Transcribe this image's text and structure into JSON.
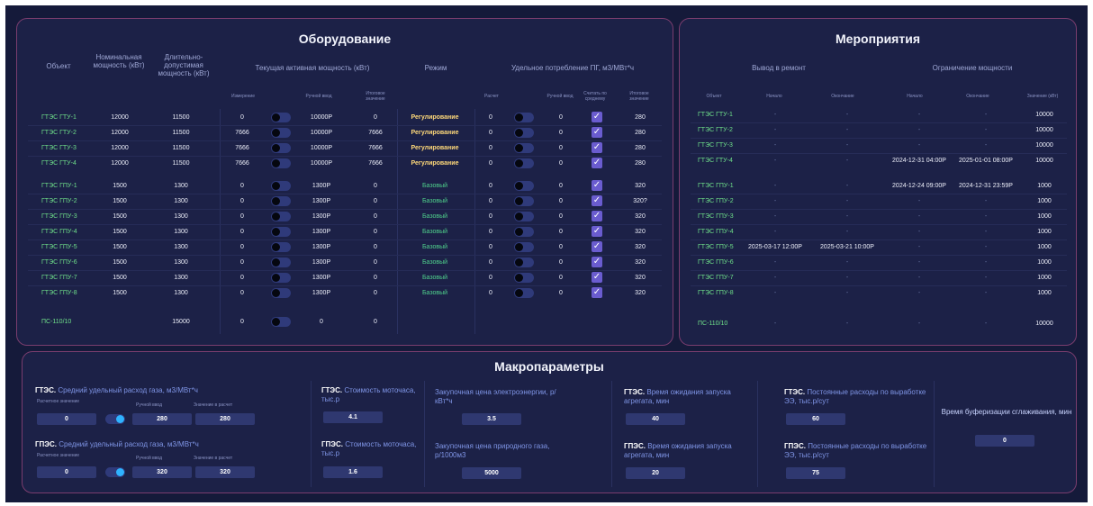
{
  "equipment": {
    "title": "Оборудование",
    "headers": {
      "object": "Объект",
      "nominal": "Номинальная мощность (кВт)",
      "longterm": "Длительно-допустимая мощность (кВт)",
      "current_power": "Текущая активная мощность (кВт)",
      "mode": "Режим",
      "specific": "Удельное потребление ПГ, м3/МВт*ч",
      "measurement": "Измерение",
      "manual": "Ручной ввод",
      "final": "Итоговое значение",
      "calc": "Расчет",
      "manual2": "Ручной ввод",
      "avg": "Считать по среднему",
      "final2": "Итоговое значение"
    },
    "rows": [
      {
        "obj": "ГТЭС ГТУ-1",
        "nom": "12000",
        "long": "11500",
        "meas": "0",
        "manual": "10000Р",
        "final": "0",
        "mode": "Регулирование",
        "calc": "0",
        "m2": "0",
        "f2": "280"
      },
      {
        "obj": "ГТЭС ГТУ-2",
        "nom": "12000",
        "long": "11500",
        "meas": "7666",
        "manual": "10000Р",
        "final": "7666",
        "mode": "Регулирование",
        "calc": "0",
        "m2": "0",
        "f2": "280"
      },
      {
        "obj": "ГТЭС ГТУ-3",
        "nom": "12000",
        "long": "11500",
        "meas": "7666",
        "manual": "10000Р",
        "final": "7666",
        "mode": "Регулирование",
        "calc": "0",
        "m2": "0",
        "f2": "280"
      },
      {
        "obj": "ГТЭС ГТУ-4",
        "nom": "12000",
        "long": "11500",
        "meas": "7666",
        "manual": "10000Р",
        "final": "7666",
        "mode": "Регулирование",
        "calc": "0",
        "m2": "0",
        "f2": "280"
      },
      {
        "obj": "ГТЭС ГПУ-1",
        "nom": "1500",
        "long": "1300",
        "meas": "0",
        "manual": "1300Р",
        "final": "0",
        "mode": "Базовый",
        "calc": "0",
        "m2": "0",
        "f2": "320"
      },
      {
        "obj": "ГТЭС ГПУ-2",
        "nom": "1500",
        "long": "1300",
        "meas": "0",
        "manual": "1300Р",
        "final": "0",
        "mode": "Базовый",
        "calc": "0",
        "m2": "0",
        "f2": "320?"
      },
      {
        "obj": "ГТЭС ГПУ-3",
        "nom": "1500",
        "long": "1300",
        "meas": "0",
        "manual": "1300Р",
        "final": "0",
        "mode": "Базовый",
        "calc": "0",
        "m2": "0",
        "f2": "320"
      },
      {
        "obj": "ГТЭС ГПУ-4",
        "nom": "1500",
        "long": "1300",
        "meas": "0",
        "manual": "1300Р",
        "final": "0",
        "mode": "Базовый",
        "calc": "0",
        "m2": "0",
        "f2": "320"
      },
      {
        "obj": "ГТЭС ГПУ-5",
        "nom": "1500",
        "long": "1300",
        "meas": "0",
        "manual": "1300Р",
        "final": "0",
        "mode": "Базовый",
        "calc": "0",
        "m2": "0",
        "f2": "320"
      },
      {
        "obj": "ГТЭС ГПУ-6",
        "nom": "1500",
        "long": "1300",
        "meas": "0",
        "manual": "1300Р",
        "final": "0",
        "mode": "Базовый",
        "calc": "0",
        "m2": "0",
        "f2": "320"
      },
      {
        "obj": "ГТЭС ГПУ-7",
        "nom": "1500",
        "long": "1300",
        "meas": "0",
        "manual": "1300Р",
        "final": "0",
        "mode": "Базовый",
        "calc": "0",
        "m2": "0",
        "f2": "320"
      },
      {
        "obj": "ГТЭС ГПУ-8",
        "nom": "1500",
        "long": "1300",
        "meas": "0",
        "manual": "1300Р",
        "final": "0",
        "mode": "Базовый",
        "calc": "0",
        "m2": "0",
        "f2": "320"
      }
    ],
    "substation": {
      "obj": "ПС-110/10",
      "long": "15000",
      "meas": "0",
      "manual": "0",
      "final": "0"
    }
  },
  "events": {
    "title": "Мероприятия",
    "repair": "Вывод в ремонт",
    "limit": "Ограничение мощности",
    "headers": {
      "object": "Объект",
      "start": "Начало",
      "end": "Окончание",
      "start2": "Начало",
      "end2": "Окончание",
      "value": "Значение (кВт)"
    },
    "rows": [
      {
        "obj": "ГТЭС ГТУ-1",
        "rs": "-",
        "re": "-",
        "ls": "-",
        "le": "-",
        "val": "10000"
      },
      {
        "obj": "ГТЭС ГТУ-2",
        "rs": "-",
        "re": "-",
        "ls": "-",
        "le": "-",
        "val": "10000"
      },
      {
        "obj": "ГТЭС ГТУ-3",
        "rs": "-",
        "re": "-",
        "ls": "-",
        "le": "-",
        "val": "10000"
      },
      {
        "obj": "ГТЭС ГТУ-4",
        "rs": "-",
        "re": "-",
        "ls": "2024-12-31 04:00Р",
        "le": "2025-01-01 08:00Р",
        "val": "10000"
      },
      {
        "obj": "ГТЭС ГПУ-1",
        "rs": "-",
        "re": "-",
        "ls": "2024-12-24 09:00Р",
        "le": "2024-12-31 23:59Р",
        "val": "1000"
      },
      {
        "obj": "ГТЭС ГПУ-2",
        "rs": "-",
        "re": "-",
        "ls": "-",
        "le": "-",
        "val": "1000"
      },
      {
        "obj": "ГТЭС ГПУ-3",
        "rs": "-",
        "re": "-",
        "ls": "-",
        "le": "-",
        "val": "1000"
      },
      {
        "obj": "ГТЭС ГПУ-4",
        "rs": "-",
        "re": "-",
        "ls": "-",
        "le": "-",
        "val": "1000"
      },
      {
        "obj": "ГТЭС ГПУ-5",
        "rs": "2025-03-17 12:00Р",
        "re": "2025-03-21 10:00Р",
        "ls": "-",
        "le": "-",
        "val": "1000"
      },
      {
        "obj": "ГТЭС ГПУ-6",
        "rs": "-",
        "re": "-",
        "ls": "-",
        "le": "-",
        "val": "1000"
      },
      {
        "obj": "ГТЭС ГПУ-7",
        "rs": "-",
        "re": "-",
        "ls": "-",
        "le": "-",
        "val": "1000"
      },
      {
        "obj": "ГТЭС ГПУ-8",
        "rs": "-",
        "re": "-",
        "ls": "-",
        "le": "-",
        "val": "1000"
      }
    ],
    "substation": {
      "obj": "ПС-110/10",
      "rs": "-",
      "re": "-",
      "ls": "-",
      "le": "-",
      "val": "10000"
    }
  },
  "macro": {
    "title": "Макропараметры",
    "gts_gas": {
      "prefix": "ГТЭС.",
      "label": "Средний удельный расход газа, м3/МВт*ч",
      "calc_label": "Расчетное значение",
      "manual_label": "Ручной ввод",
      "used_label": "Значение в расчет",
      "calc": "0",
      "manual": "280",
      "used": "280"
    },
    "gpes_gas": {
      "prefix": "ГПЭС.",
      "label": "Средний удельный расход газа, м3/МВт*ч",
      "calc_label": "Расчетное значение",
      "manual_label": "Ручной ввод",
      "used_label": "Значение в расчет",
      "calc": "0",
      "manual": "320",
      "used": "320"
    },
    "gts_motohour": {
      "prefix": "ГТЭС.",
      "label": "Стоимость моточаса, тыс.р",
      "value": "4.1"
    },
    "gpes_motohour": {
      "prefix": "ГПЭС.",
      "label": "Стоимость моточаса, тыс.р",
      "value": "1.6"
    },
    "el_price": {
      "label": "Закупочная цена электроэнергии, р/кВт*ч",
      "value": "3.5"
    },
    "gas_price": {
      "label": "Закупочная цена природного газа, р/1000м3",
      "value": "5000"
    },
    "gts_wait": {
      "prefix": "ГТЭС.",
      "label": "Время ожидания запуска агрегата, мин",
      "value": "40"
    },
    "gpes_wait": {
      "prefix": "ГПЭС.",
      "label": "Время ожидания запуска агрегата, мин",
      "value": "20"
    },
    "gts_fixed": {
      "prefix": "ГТЭС.",
      "label": "Постоянные расходы по выработке ЭЭ, тыс.р/сут",
      "value": "60"
    },
    "gpes_fixed": {
      "prefix": "ГПЭС.",
      "label": "Постоянные расходы по выработке ЭЭ, тыс.р/сут",
      "value": "75"
    },
    "buffer": {
      "label": "Время буферизации сглаживания, мин",
      "value": "0"
    }
  },
  "colors": {
    "accent": "#6a5ccf",
    "object_green": "#6fe08a",
    "mode_reg": "#ffd97a",
    "mode_base": "#4fd18c",
    "border": "#7a3d6e"
  }
}
